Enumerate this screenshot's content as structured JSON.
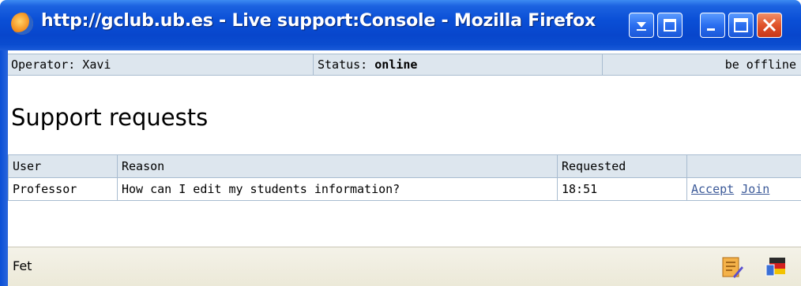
{
  "window": {
    "title": "http://gclub.ub.es - Live support:Console - Mozilla Firefox"
  },
  "infobar": {
    "operator": "Operator: Xavi",
    "status_label": "Status: ",
    "status_value": "online",
    "offline_link": "be offline"
  },
  "page": {
    "heading": "Support requests"
  },
  "table": {
    "headers": [
      "User",
      "Reason",
      "Requested",
      ""
    ],
    "rows": [
      {
        "user": "Professor",
        "reason": "How can I edit my students information?",
        "requested": "18:51",
        "accept_label": "Accept",
        "join_label": "Join"
      }
    ]
  },
  "statusbar": {
    "text": "Fet"
  },
  "icons": {
    "browser": "firefox-icon",
    "statusbar_right": [
      "edit-note-icon",
      "flag-icon"
    ]
  },
  "colors": {
    "titlebar": "#0a4fd6",
    "header_bg": "#dde6ee",
    "link": "#3b5998",
    "statusbar_bg": "#ece9d8"
  }
}
